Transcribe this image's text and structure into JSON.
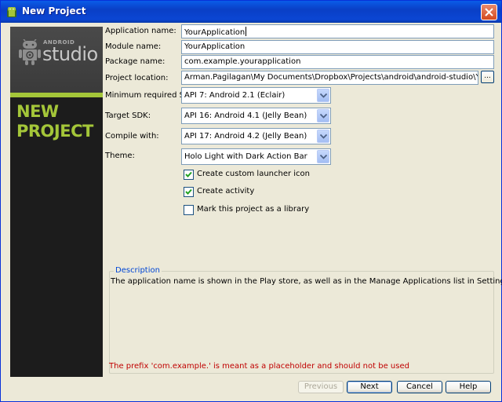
{
  "window": {
    "title": "New Project",
    "title_bar_color": "#0a4fd6"
  },
  "sidebar": {
    "logo_small": "ANDROID",
    "logo_large": "studio",
    "heading_line1": "NEW",
    "heading_line2": "PROJECT",
    "accent_color": "#a4c639"
  },
  "form": {
    "application_name": {
      "label": "Application name:",
      "value": "YourApplication"
    },
    "module_name": {
      "label": "Module name:",
      "value": "YourApplication"
    },
    "package_name": {
      "label": "Package name:",
      "value": "com.example.yourapplication"
    },
    "project_location": {
      "label": "Project location:",
      "value": "Arman.Pagilagan\\My Documents\\Dropbox\\Projects\\android\\android-studio\\YourApplicationProject",
      "browse_label": "..."
    },
    "min_sdk": {
      "label": "Minimum required SDK:",
      "value": "API 7: Android 2.1 (Eclair)"
    },
    "target_sdk": {
      "label": "Target SDK:",
      "value": "API 16: Android 4.1 (Jelly Bean)"
    },
    "compile_with": {
      "label": "Compile with:",
      "value": "API 17: Android 4.2 (Jelly Bean)"
    },
    "theme": {
      "label": "Theme:",
      "value": "Holo Light with Dark Action Bar"
    },
    "checkboxes": [
      {
        "label": "Create custom launcher icon",
        "checked": true
      },
      {
        "label": "Create activity",
        "checked": true
      },
      {
        "label": "Mark this project as a library",
        "checked": false
      }
    ]
  },
  "description": {
    "title": "Description",
    "text": "The application name is shown in the Play store, as well as in the Manage Applications list in Settings."
  },
  "warning": {
    "text": "The prefix 'com.example.' is meant as a placeholder and should not be used",
    "color": "#c00000"
  },
  "buttons": {
    "previous": "Previous",
    "next": "Next",
    "cancel": "Cancel",
    "help": "Help"
  },
  "icons": {
    "title": "android-studio-icon",
    "close": "close-icon",
    "dropdown": "chevron-down-icon",
    "check": "check-icon",
    "logo": "android-robot-icon"
  }
}
